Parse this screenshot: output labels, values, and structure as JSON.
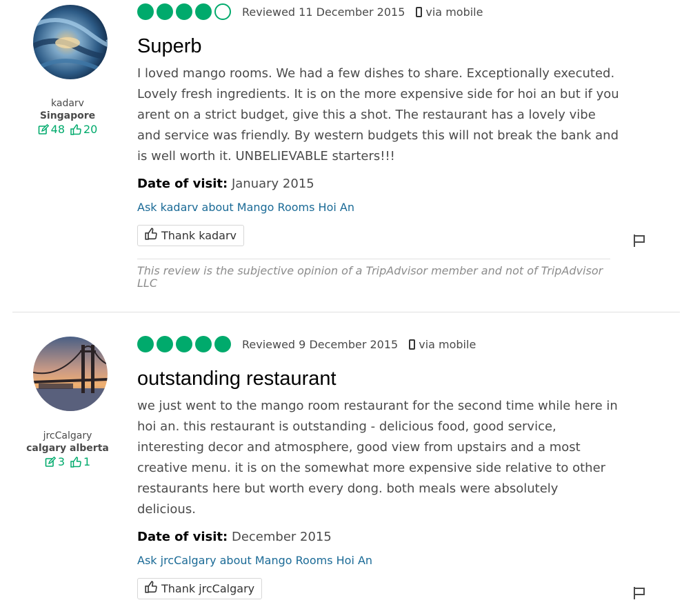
{
  "reviews": [
    {
      "username": "kadarv",
      "location": "Singapore",
      "contributions": "48",
      "helpful_votes": "20",
      "rating": 4,
      "review_date": "Reviewed 11 December 2015",
      "device": "via mobile",
      "title": "Superb",
      "text": "I loved mango rooms. We had a few dishes to share. Exceptionally executed. Lovely fresh ingredients. It is on the more expensive side for hoi an but if you arent on a strict budget, give this a shot. The restaurant has a lovely vibe and service was friendly. By western budgets this will not break the bank and is well worth it. UNBELIEVABLE starters!!!",
      "visit_label": "Date of visit:",
      "visit_date": "January 2015",
      "ask_link": "Ask kadarv about Mango Rooms Hoi An",
      "thank_label": "Thank kadarv",
      "disclaimer": "This review is the subjective opinion of a TripAdvisor member and not of TripAdvisor LLC"
    },
    {
      "username": "jrcCalgary",
      "location": "calgary alberta",
      "contributions": "3",
      "helpful_votes": "1",
      "rating": 5,
      "review_date": "Reviewed 9 December 2015",
      "device": "via mobile",
      "title": "outstanding restaurant",
      "text": "we just went to the mango room restaurant for the second time while here in hoi an. this restaurant is outstanding - delicious food, good service, interesting decor and atmosphere, good view from upstairs and a most creative menu. it is on the somewhat more expensive side relative to other restaurants here but worth every dong. both meals were absolutely delicious.",
      "visit_label": "Date of visit:",
      "visit_date": "December 2015",
      "ask_link": "Ask jrcCalgary about Mango Rooms Hoi An",
      "thank_label": "Thank jrcCalgary"
    }
  ],
  "colors": {
    "accent": "#00aa6c",
    "link": "#1a6a96"
  },
  "icons": [
    "mobile-phone-icon",
    "edit-icon",
    "thumbs-up-icon",
    "flag-icon"
  ]
}
